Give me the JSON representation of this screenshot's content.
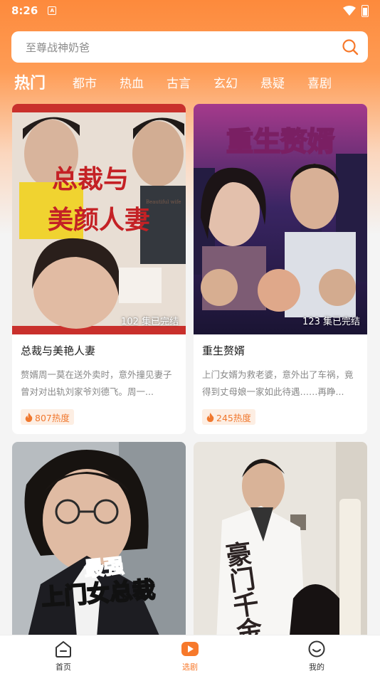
{
  "status_bar": {
    "time": "8:26",
    "notif_glyph": "A"
  },
  "search": {
    "placeholder": "至尊战神奶爸"
  },
  "tabs": [
    {
      "label": "热门",
      "active": true
    },
    {
      "label": "都市"
    },
    {
      "label": "热血"
    },
    {
      "label": "古言"
    },
    {
      "label": "玄幻"
    },
    {
      "label": "悬疑"
    },
    {
      "label": "喜剧"
    }
  ],
  "cards": [
    {
      "cover_title": "总裁与美颜人妻",
      "cover_subtitle": "Beautiful wife",
      "episodes": "102 集已完结",
      "title": "总裁与美艳人妻",
      "desc": "赘婿周一莫在送外卖时，意外撞见妻子曾对对出轨刘家爷刘德飞。周一...",
      "hot": "807热度"
    },
    {
      "cover_title": "重生赘婿",
      "episodes": "123 集已完结",
      "title": "重生赘婿",
      "desc": "上门女婿为救老婆，意外出了车祸，竟得到丈母娘一家如此待遇……再睁...",
      "hot": "245热度"
    },
    {
      "cover_title_small": "最强",
      "cover_title": "上门女总裁"
    },
    {
      "cover_title": "豪门千金爱上"
    }
  ],
  "tabbar": [
    {
      "label": "首页",
      "icon": "home-icon"
    },
    {
      "label": "选剧",
      "icon": "play-icon",
      "active": true
    },
    {
      "label": "我的",
      "icon": "profile-icon"
    }
  ],
  "colors": {
    "accent": "#f7792b",
    "header_gradient_top": "#fd8a3c"
  }
}
